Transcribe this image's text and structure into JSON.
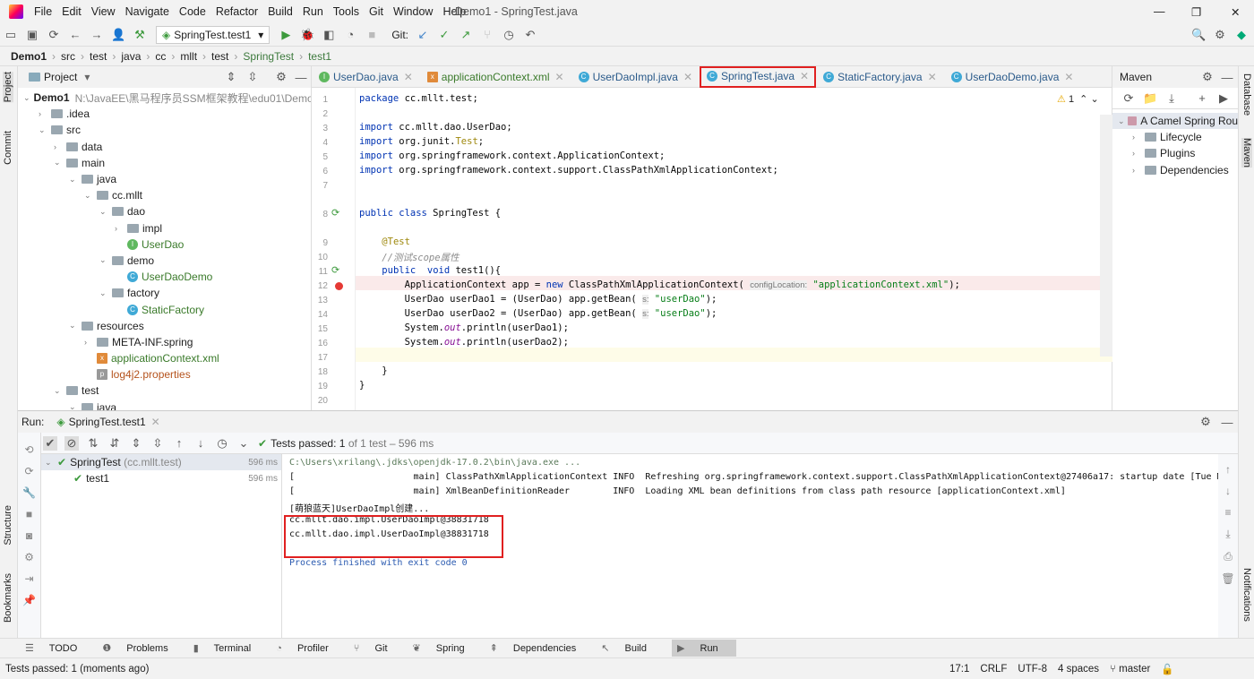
{
  "menu": [
    "File",
    "Edit",
    "View",
    "Navigate",
    "Code",
    "Refactor",
    "Build",
    "Run",
    "Tools",
    "Git",
    "Window",
    "Help"
  ],
  "window_title": "Demo1 - SpringTest.java",
  "toolbar": {
    "run_config": "SpringTest.test1",
    "git_label": "Git:"
  },
  "breadcrumb": [
    "Demo1",
    "src",
    "test",
    "java",
    "cc",
    "mllt",
    "test",
    "SpringTest",
    "test1"
  ],
  "left_stripe": [
    "Project",
    "Commit",
    "Structure",
    "Bookmarks"
  ],
  "right_stripe": [
    "Database",
    "Maven",
    "Notifications"
  ],
  "project": {
    "title": "Project",
    "root": "Demo1",
    "root_path": "N:\\JavaEE\\黑马程序员SSM框架教程\\edu01\\Demo",
    "items": [
      {
        "d": 1,
        "t": ".idea",
        "k": "folder",
        "c": true
      },
      {
        "d": 1,
        "t": "src",
        "k": "folder",
        "o": true
      },
      {
        "d": 2,
        "t": "data",
        "k": "folder",
        "c": true
      },
      {
        "d": 2,
        "t": "main",
        "k": "folder",
        "o": true
      },
      {
        "d": 3,
        "t": "java",
        "k": "folder",
        "o": true
      },
      {
        "d": 4,
        "t": "cc.mllt",
        "k": "folder",
        "o": true
      },
      {
        "d": 5,
        "t": "dao",
        "k": "folder",
        "o": true
      },
      {
        "d": 6,
        "t": "impl",
        "k": "folder",
        "c": true
      },
      {
        "d": 6,
        "t": "UserDao",
        "k": "iface"
      },
      {
        "d": 5,
        "t": "demo",
        "k": "folder",
        "o": true
      },
      {
        "d": 6,
        "t": "UserDaoDemo",
        "k": "class"
      },
      {
        "d": 5,
        "t": "factory",
        "k": "folder",
        "o": true
      },
      {
        "d": 6,
        "t": "StaticFactory",
        "k": "class"
      },
      {
        "d": 3,
        "t": "resources",
        "k": "folder",
        "o": true
      },
      {
        "d": 4,
        "t": "META-INF.spring",
        "k": "folder",
        "c": true
      },
      {
        "d": 4,
        "t": "applicationContext.xml",
        "k": "xml"
      },
      {
        "d": 4,
        "t": "log4j2.properties",
        "k": "prop"
      },
      {
        "d": 2,
        "t": "test",
        "k": "folder",
        "o": true
      },
      {
        "d": 3,
        "t": "java",
        "k": "folder",
        "o": true
      }
    ]
  },
  "tabs": [
    {
      "label": "UserDao.java",
      "k": "iface"
    },
    {
      "label": "applicationContext.xml",
      "k": "xml"
    },
    {
      "label": "UserDaoImpl.java",
      "k": "class"
    },
    {
      "label": "SpringTest.java",
      "k": "class",
      "active": true
    },
    {
      "label": "StaticFactory.java",
      "k": "class"
    },
    {
      "label": "UserDaoDemo.java",
      "k": "class"
    }
  ],
  "editor": {
    "warnings": "1",
    "code": [
      "<span class='kw'>package</span> cc.mllt.test;",
      "",
      "<span class='kw'>import</span> cc.mllt.dao.UserDao;",
      "<span class='kw'>import</span> org.junit.<span class='an'>Test</span>;",
      "<span class='kw'>import</span> org.springframework.context.ApplicationContext;",
      "<span class='kw'>import</span> org.springframework.context.support.ClassPathXmlApplicationContext;",
      "",
      "<span class='kw'>public class</span> SpringTest {",
      "    <span class='an'>@Test</span>",
      "    <span class='cm'>//测试scope属性</span>",
      "    <span class='kw'>public  void</span> test1(){",
      "        ApplicationContext app = <span class='kw'>new</span> ClassPathXmlApplicationContext( <span class='hint'>configLocation:</span> <span class='str'>\"applicationContext.xml\"</span>);",
      "        UserDao userDao1 = (UserDao) app.getBean( <span class='hint'>s:</span> <span class='str'>\"userDao\"</span>);",
      "        UserDao userDao2 = (UserDao) app.getBean( <span class='hint'>s:</span> <span class='str'>\"userDao\"</span>);",
      "        System.<span class='cm' style='color:#871094'>out</span>.println(userDao1);",
      "        System.<span class='cm' style='color:#871094'>out</span>.println(userDao2);",
      "",
      "    }",
      "}",
      ""
    ]
  },
  "maven": {
    "title": "Maven",
    "project": "A Camel Spring Rou",
    "items": [
      "Lifecycle",
      "Plugins",
      "Dependencies"
    ]
  },
  "run": {
    "label": "Run:",
    "tab": "SpringTest.test1",
    "status_prefix": "Tests passed:",
    "status_count": "1",
    "status_suffix": "of 1 test – 596 ms",
    "tree": [
      {
        "name": "SpringTest",
        "pkg": "(cc.mllt.test)",
        "time": "596 ms"
      },
      {
        "name": "test1",
        "pkg": "",
        "time": "596 ms"
      }
    ],
    "console": [
      "C:\\Users\\xrilang\\.jdks\\openjdk-17.0.2\\bin\\java.exe ...",
      "[                      main] ClassPathXmlApplicationContext INFO  Refreshing org.springframework.context.support.ClassPathXmlApplicationContext@27406a17: startup date [Tue M",
      "[                      main] XmlBeanDefinitionReader        INFO  Loading XML bean definitions from class path resource [applicationContext.xml]",
      "[萌狼蓝天]UserDaoImpl创建...",
      "cc.mllt.dao.impl.UserDaoImpl@38831718",
      "cc.mllt.dao.impl.UserDaoImpl@38831718",
      "",
      "Process finished with exit code 0"
    ]
  },
  "bottom_tools": [
    "TODO",
    "Problems",
    "Terminal",
    "Profiler",
    "Git",
    "Spring",
    "Dependencies",
    "Build",
    "Run"
  ],
  "status": {
    "message": "Tests passed: 1 (moments ago)",
    "position": "17:1",
    "line_sep": "CRLF",
    "encoding": "UTF-8",
    "indent": "4 spaces",
    "branch": "master"
  },
  "colors": {
    "accent": "#4083c9",
    "highlight_box": "#e02020",
    "breakpoint": "#e53935",
    "pass": "#3d9a3d"
  }
}
